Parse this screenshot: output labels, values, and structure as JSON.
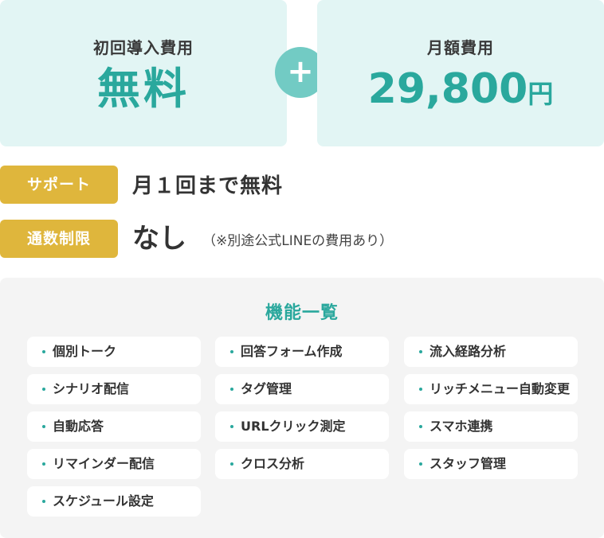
{
  "pricing": {
    "initial_label": "初回導入費用",
    "initial_value": "無料",
    "plus_symbol": "+",
    "monthly_label": "月額費用",
    "monthly_value": "29,800",
    "monthly_unit": "円"
  },
  "info": {
    "support_badge": "サポート",
    "support_text": "月１回まで無料",
    "limit_badge": "通数制限",
    "limit_text": "なし",
    "limit_note": "（※別途公式LINEの費用あり）"
  },
  "features": {
    "title": "機能一覧",
    "columns": [
      [
        "個別トーク",
        "シナリオ配信",
        "自動応答",
        "リマインダー配信",
        "スケジュール設定"
      ],
      [
        "回答フォーム作成",
        "タグ管理",
        "URLクリック測定",
        "クロス分析"
      ],
      [
        "流入経路分析",
        "リッチメニュー自動変更",
        "スマホ連携",
        "スタッフ管理"
      ]
    ]
  },
  "colors": {
    "teal": "#2aa89d",
    "card_bg": "#e2f5f4",
    "badge_gold": "#dfb63c",
    "panel_bg": "#f4f4f4"
  }
}
